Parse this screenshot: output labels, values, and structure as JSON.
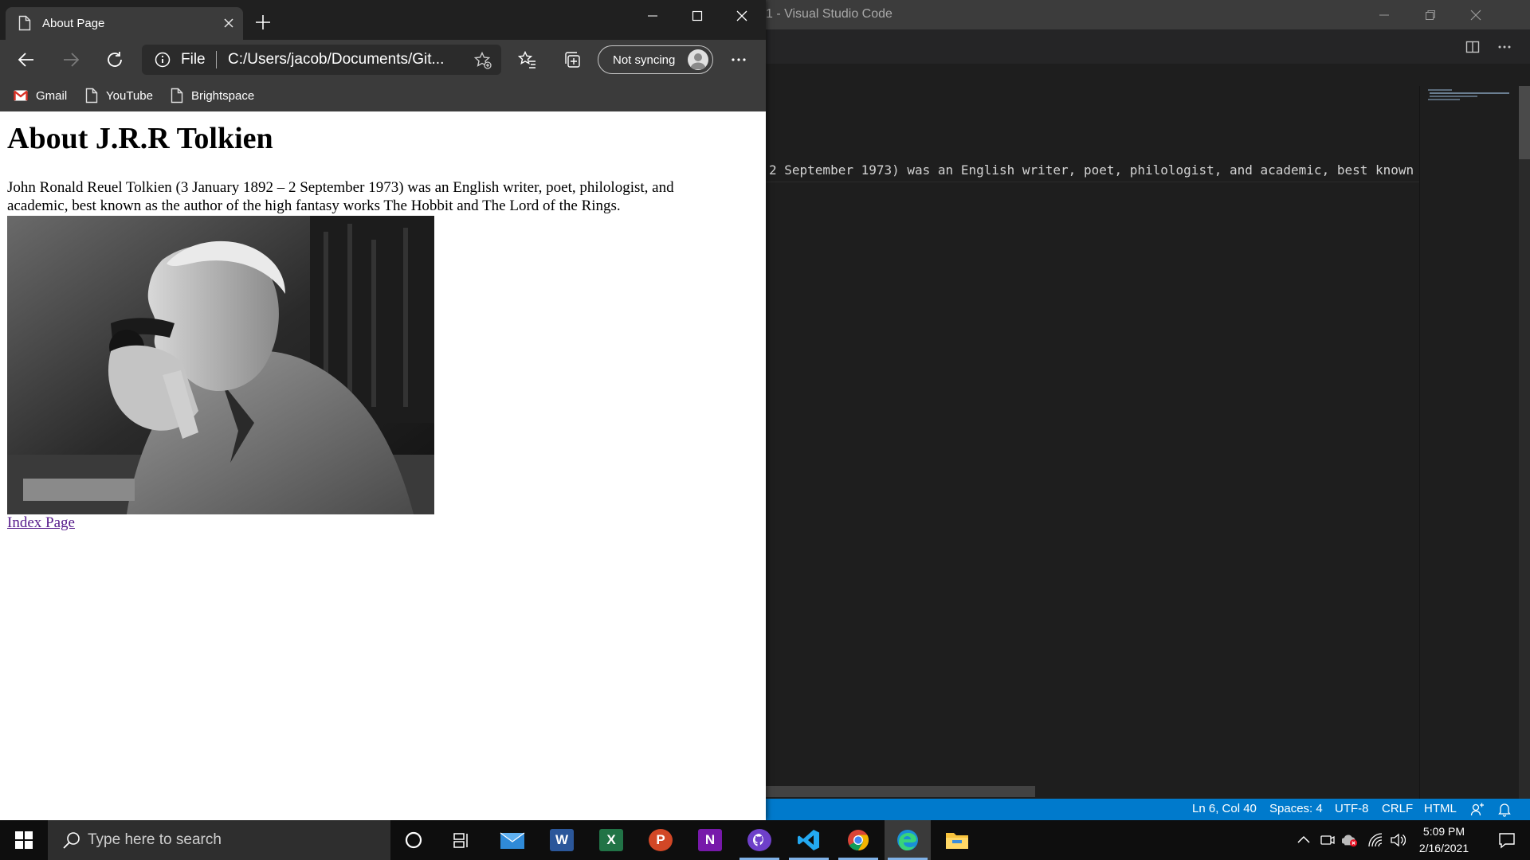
{
  "vscode": {
    "title": "1 - Visual Studio Code",
    "code_line": "2 September 1973) was an English writer, poet, philologist, and academic, best known",
    "status": {
      "position": "Ln 6, Col 40",
      "spaces": "Spaces: 4",
      "encoding": "UTF-8",
      "eol": "CRLF",
      "language": "HTML"
    }
  },
  "edge": {
    "tab_title": "About Page",
    "address_scheme": "File",
    "address_url": "C:/Users/jacob/Documents/Git...",
    "profile_label": "Not syncing",
    "bookmarks": [
      {
        "label": "Gmail",
        "icon": "gmail-icon"
      },
      {
        "label": "YouTube",
        "icon": "page-icon"
      },
      {
        "label": "Brightspace",
        "icon": "page-icon"
      }
    ]
  },
  "page": {
    "heading": "About J.R.R Tolkien",
    "paragraph": "John Ronald Reuel Tolkien (3 January 1892 – 2 September 1973) was an English writer, poet, philologist, and academic, best known as the author of the high fantasy works The Hobbit and The Lord of the Rings.",
    "link": "Index Page"
  },
  "taskbar": {
    "search_placeholder": "Type here to search",
    "time": "5:09 PM",
    "date": "2/16/2021",
    "apps": [
      "cortana-icon",
      "task-view-icon",
      "mail-icon",
      "word-icon",
      "excel-icon",
      "powerpoint-icon",
      "onenote-icon",
      "github-desktop-icon",
      "vscode-icon",
      "chrome-icon",
      "edge-icon",
      "file-explorer-icon"
    ]
  },
  "colors": {
    "vscode_statusbar": "#007acc",
    "edge_toolbar": "#3b3b3b",
    "link_visited": "#551a8b"
  }
}
